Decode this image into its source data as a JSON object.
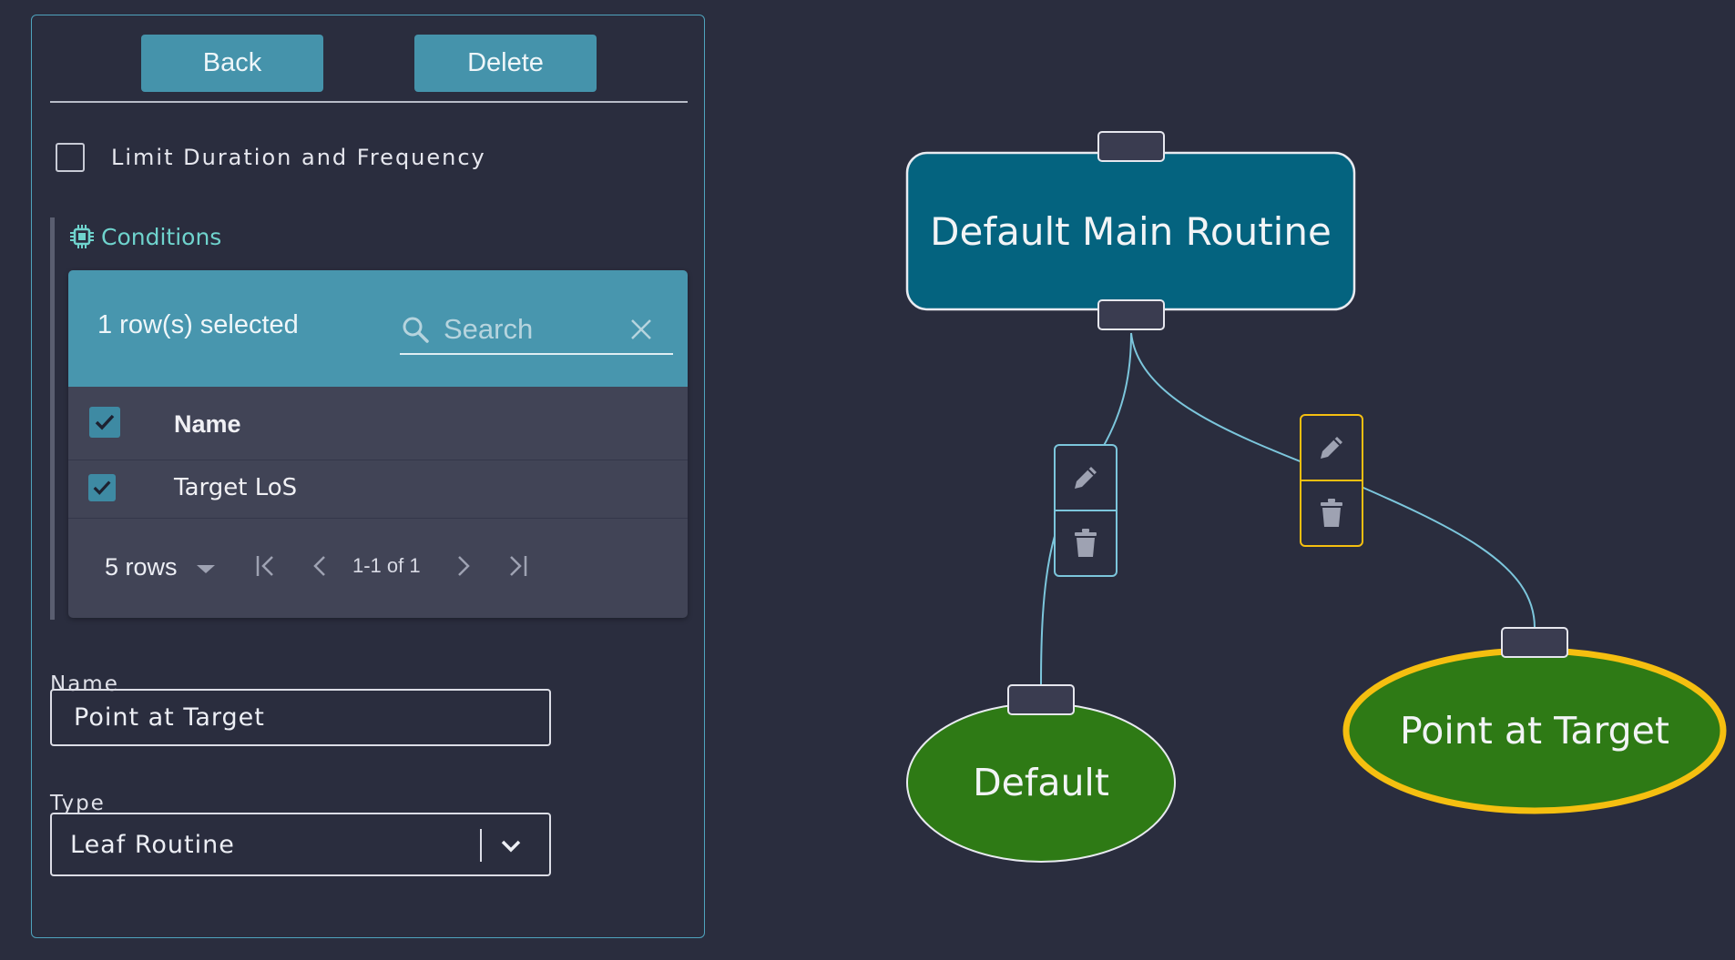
{
  "panel": {
    "back_label": "Back",
    "delete_label": "Delete",
    "limit_label": "Limit Duration and Frequency",
    "conditions_title": "Conditions",
    "table": {
      "selection_text": "1 row(s) selected",
      "search_placeholder": "Search",
      "column_name": "Name",
      "rows": [
        {
          "name": "Target LoS",
          "checked": true
        }
      ],
      "rows_per_page": "5 rows",
      "page_info": "1-1 of 1"
    },
    "name_label": "Name",
    "name_value": "Point at Target",
    "type_label": "Type",
    "type_value": "Leaf Routine"
  },
  "graph": {
    "main_node": "Default Main Routine",
    "child_default": "Default",
    "child_point": "Point at Target"
  },
  "colors": {
    "background": "#2a2d3e",
    "accent": "#4896ae",
    "main_node": "#04637f",
    "leaf_node": "#2e7a15",
    "selected_outline": "#f5bf10",
    "edge": "#7cc6dc",
    "conditions_text": "#6fd3cd"
  }
}
